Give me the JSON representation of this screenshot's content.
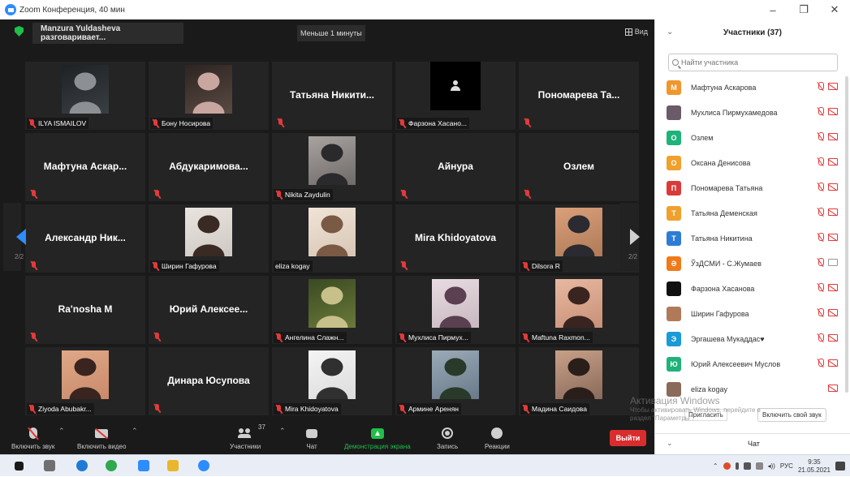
{
  "window": {
    "title": "Zoom Конференция, 40 мин",
    "minimize": "–",
    "maximize": "❐",
    "close": "✕"
  },
  "topbar": {
    "speaking": "Manzura Yuldasheva разговаривает...",
    "timer": "Меньше 1 минуты",
    "view": "Вид"
  },
  "tiles": [
    {
      "type": "photo",
      "label": "ILYA ISMAILOV",
      "photo": [
        "#3a3f44",
        "#8c8f93",
        "#1f2224"
      ]
    },
    {
      "type": "photo",
      "label": "Бону Носирова",
      "photo": [
        "#5a4a44",
        "#c9a7a0",
        "#2d2420"
      ]
    },
    {
      "type": "name",
      "name": "Татьяна Никити..."
    },
    {
      "type": "avatar",
      "label": "Фарзона Хасано..."
    },
    {
      "type": "name",
      "name": "Пономарева Та..."
    },
    {
      "type": "name",
      "name": "Мафтуна Аскар..."
    },
    {
      "type": "name",
      "name": "Абдукаримова..."
    },
    {
      "type": "photo",
      "label": "Nikita Zaydulin",
      "photo": [
        "#6e6a68",
        "#2a2a2c",
        "#a9a3a0"
      ]
    },
    {
      "type": "name",
      "name": "Айнура"
    },
    {
      "type": "name",
      "name": "Озлем"
    },
    {
      "type": "name",
      "name": "Александр Ник..."
    },
    {
      "type": "photo",
      "label": "Ширин Гафурова",
      "photo": [
        "#cfc9c4",
        "#3a2a24",
        "#eae4df"
      ]
    },
    {
      "type": "photo",
      "label": "eliza kogay",
      "mic": false,
      "photo": [
        "#d8c6b4",
        "#7a5a44",
        "#f0e4d8"
      ]
    },
    {
      "type": "name",
      "name": "Mira Khidoyatova"
    },
    {
      "type": "photo",
      "label": "Dilsora R",
      "photo": [
        "#b07a58",
        "#2a2a30",
        "#d9a07a"
      ]
    },
    {
      "type": "name",
      "name": "Ra'nosha M"
    },
    {
      "type": "name",
      "name": "Юрий Алексее..."
    },
    {
      "type": "photo",
      "label": "Ангелина Слажн...",
      "photo": [
        "#6a7a3a",
        "#c8c08a",
        "#3a4a22"
      ]
    },
    {
      "type": "photo",
      "label": "Мухлиса Пирмух...",
      "photo": [
        "#c8b8c0",
        "#5a4050",
        "#e8dce2"
      ]
    },
    {
      "type": "photo",
      "label": "Maftuna Raxmon...",
      "photo": [
        "#c89078",
        "#3a2420",
        "#e8b8a0"
      ]
    },
    {
      "type": "photo",
      "label": "Ziyoda Abubakr...",
      "photo": [
        "#c88a6a",
        "#3a2420",
        "#e0a888"
      ]
    },
    {
      "type": "name",
      "name": "Динара Юсупова"
    },
    {
      "type": "photo",
      "label": "Mira Khidoyatova",
      "photo": [
        "#dcdcdc",
        "#303030",
        "#f4f4f4"
      ]
    },
    {
      "type": "photo",
      "label": "Армине Аренян",
      "photo": [
        "#6a7a8a",
        "#2a3a2a",
        "#9aaab8"
      ]
    },
    {
      "type": "photo",
      "label": "Мадина Саидова",
      "photo": [
        "#8a6a5a",
        "#2a1e1a",
        "#c8a088"
      ]
    }
  ],
  "pagination": {
    "left": "2/2",
    "right": "2/2"
  },
  "toolbar": {
    "mic": "Включить звук",
    "video": "Включить видео",
    "participants": "Участники",
    "participants_count": "37",
    "chat": "Чат",
    "share": "Демонстрация экрана",
    "record": "Запись",
    "reactions": "Реакции",
    "leave": "Выйти"
  },
  "panel": {
    "title": "Участники (37)",
    "search_placeholder": "Найти участника",
    "participants": [
      {
        "initial": "М",
        "color": "#f0962d",
        "name": "Мафтуна Аскарова",
        "cam": "off"
      },
      {
        "initial": "",
        "color": "#6a5a6a",
        "name": "Мухлиса Пирмухамедова",
        "cam": "off"
      },
      {
        "initial": "О",
        "color": "#1fb27a",
        "name": "Озлем",
        "cam": "off"
      },
      {
        "initial": "О",
        "color": "#f0a02d",
        "name": "Оксана Денисова",
        "cam": "off"
      },
      {
        "initial": "П",
        "color": "#d93a3a",
        "name": "Пономарева Татьяна",
        "cam": "off"
      },
      {
        "initial": "Т",
        "color": "#f0a02d",
        "name": "Татьяна Деменская",
        "cam": "off"
      },
      {
        "initial": "Т",
        "color": "#2d7cd6",
        "name": "Татьяна Никитина",
        "cam": "off"
      },
      {
        "initial": "Ә",
        "color": "#f07a1a",
        "name": "ЎзДСМИ - С.Жумаев",
        "cam": "on"
      },
      {
        "initial": "",
        "color": "#111111",
        "name": "Фарзона Хасанова",
        "cam": "off"
      },
      {
        "initial": "",
        "color": "#b07a5a",
        "name": "Ширин Гафурова",
        "cam": "off"
      },
      {
        "initial": "Э",
        "color": "#1a9ad6",
        "name": "Эргашева Мукаддас♥",
        "cam": "off"
      },
      {
        "initial": "Ю",
        "color": "#1fb27a",
        "name": "Юрий Алексеевич Муслов",
        "cam": "off"
      },
      {
        "initial": "",
        "color": "#8a6a5a",
        "name": "eliza kogay",
        "cam": "off",
        "mic": false
      }
    ],
    "invite": "Пригласить",
    "unmute_self": "Включить свой звук",
    "chat_title": "Чат"
  },
  "activation": {
    "title": "Активация Windows",
    "line1": "Чтобы активировать Windows, перейдите в",
    "line2": "раздел \"Параметры\"."
  },
  "taskbar": {
    "lang": "РУС",
    "time": "9:35",
    "date": "21.05.2021"
  }
}
